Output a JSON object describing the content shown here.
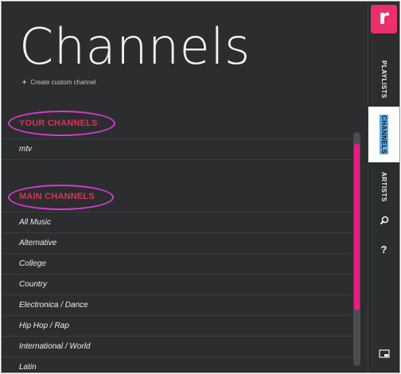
{
  "page": {
    "title": "Channels",
    "create_custom_label": "Create custom channel"
  },
  "your_channels": {
    "header": "YOUR CHANNELS",
    "items": [
      "mtv"
    ]
  },
  "main_channels": {
    "header": "MAIN CHANNELS",
    "items": [
      "All Music",
      "Alternative",
      "College",
      "Country",
      "Electronica / Dance",
      "Hip Hop / Rap",
      "International / World",
      "Latin"
    ]
  },
  "sidebar": {
    "logo_letter": "r",
    "tabs": [
      {
        "label": "PLAYLISTS",
        "active": false
      },
      {
        "label": "CHANNELS",
        "active": true
      },
      {
        "label": "ARTISTS",
        "active": false
      }
    ],
    "help_label": "?",
    "icons": [
      "search-icon",
      "help-icon",
      "fullscreen-icon"
    ]
  },
  "colors": {
    "background": "#2b2d2f",
    "accent_pink": "#ea1a7f",
    "section_header": "#d6355a",
    "active_tab_highlight": "#5aa9e8"
  }
}
